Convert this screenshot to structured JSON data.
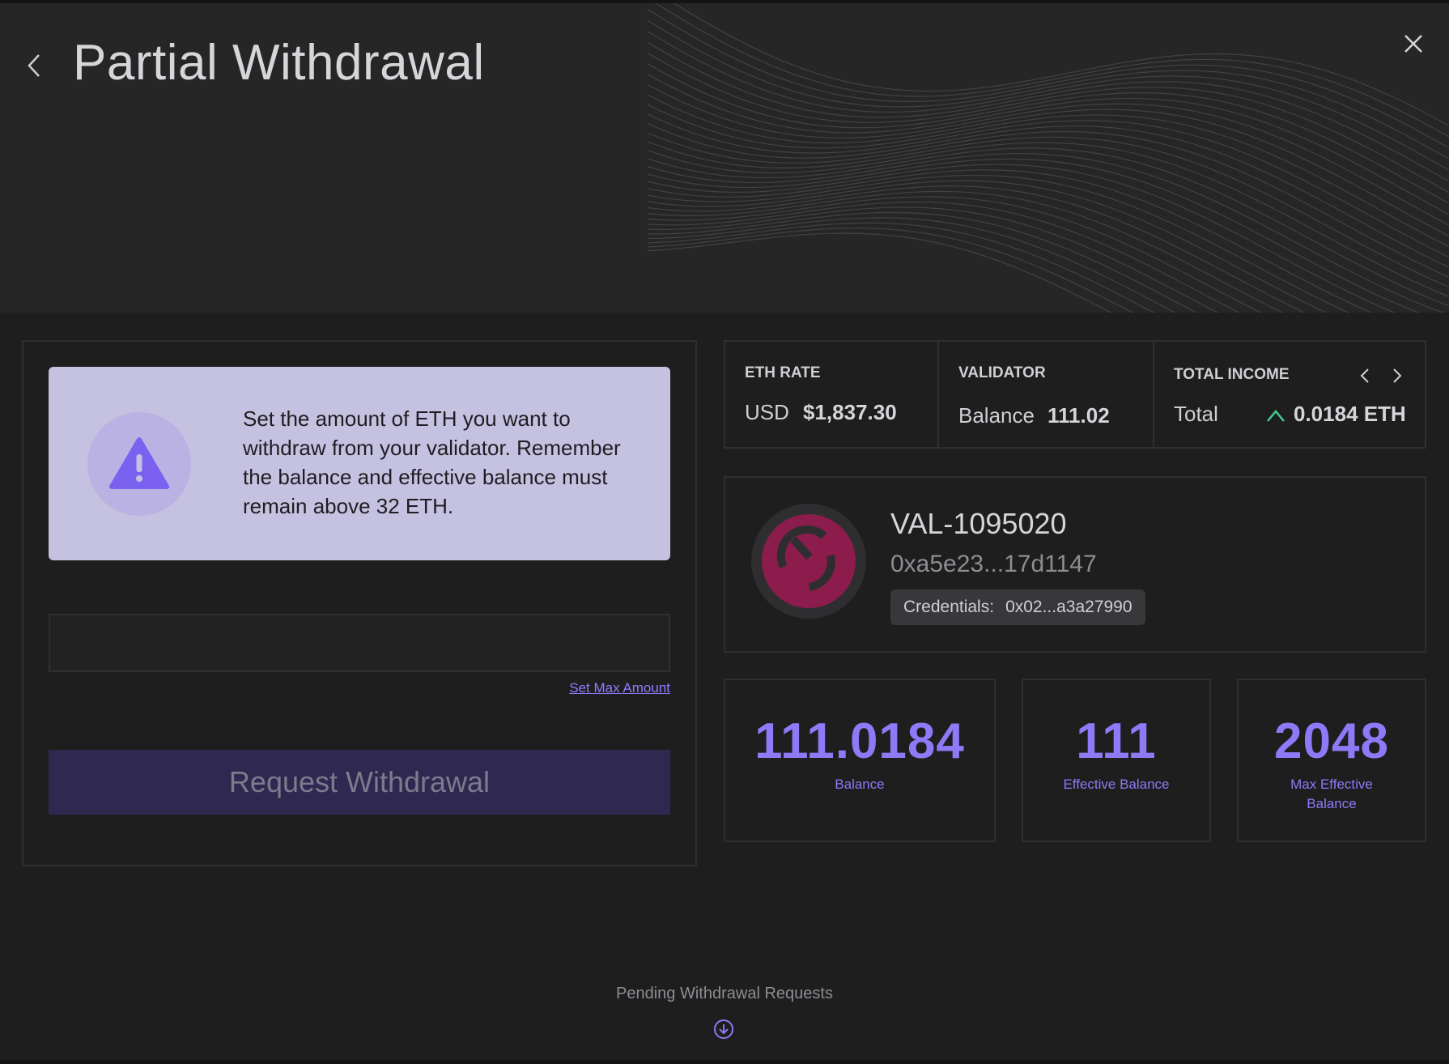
{
  "header": {
    "title": "Partial Withdrawal"
  },
  "info": {
    "message": "Set the amount of ETH you want to withdraw from your validator. Remember the balance and effective balance must remain above 32 ETH."
  },
  "form": {
    "amount_value": "",
    "amount_placeholder": "",
    "set_max_label": "Set Max Amount",
    "request_label": "Request Withdrawal"
  },
  "stats": {
    "eth_rate": {
      "label": "ETH RATE",
      "sub": "USD",
      "value": "$1,837.30"
    },
    "validator": {
      "label": "VALIDATOR",
      "sub": "Balance",
      "value": "111.02"
    },
    "total_income": {
      "label": "TOTAL INCOME",
      "sub": "Total",
      "value": "0.0184 ETH",
      "trend_color": "#3ecf8e"
    }
  },
  "validator": {
    "name": "VAL-1095020",
    "address": "0xa5e23...17d1147",
    "credentials_label": "Credentials:",
    "credentials_value": "0x02...a3a27990",
    "avatar_color": "#8c1c4c"
  },
  "metrics": [
    {
      "value": "111.0184",
      "label": "Balance"
    },
    {
      "value": "111",
      "label": "Effective Balance"
    },
    {
      "value": "2048",
      "label": "Max Effective Balance"
    }
  ],
  "footer": {
    "pending_label": "Pending Withdrawal Requests"
  },
  "colors": {
    "accent": "#8c7af6",
    "info_bg": "#c5c1e0",
    "warning_icon": "#7b61f0",
    "button_bg": "#2f2850"
  }
}
